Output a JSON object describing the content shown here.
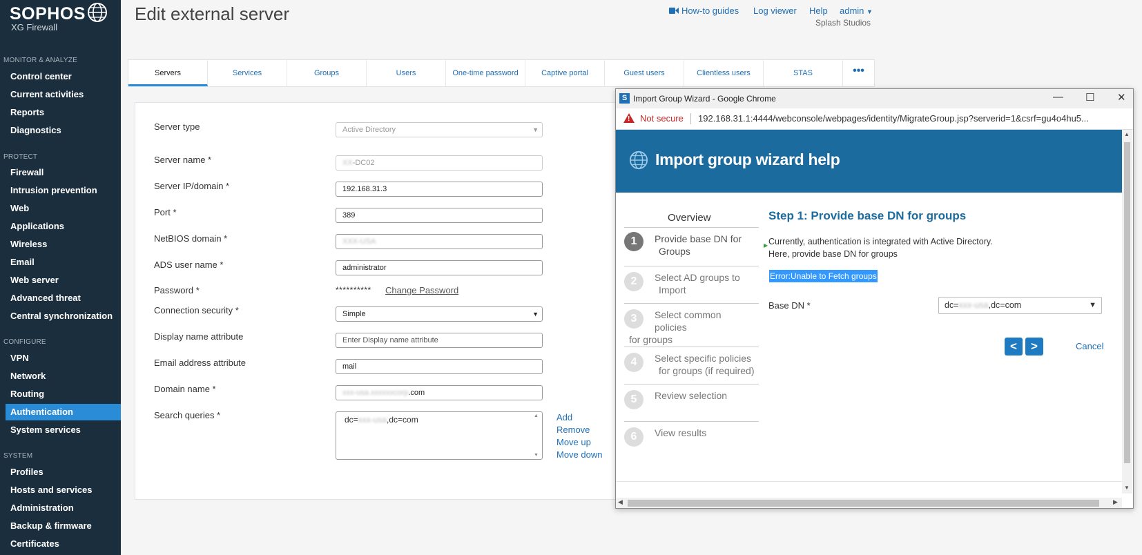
{
  "brand": {
    "name": "SOPHOS",
    "product": "XG Firewall"
  },
  "sidebar": {
    "sections": [
      {
        "title": "MONITOR & ANALYZE",
        "items": [
          "Control center",
          "Current activities",
          "Reports",
          "Diagnostics"
        ]
      },
      {
        "title": "PROTECT",
        "items": [
          "Firewall",
          "Intrusion prevention",
          "Web",
          "Applications",
          "Wireless",
          "Email",
          "Web server",
          "Advanced threat",
          "Central synchronization"
        ]
      },
      {
        "title": "CONFIGURE",
        "items": [
          "VPN",
          "Network",
          "Routing",
          "Authentication",
          "System services"
        ]
      },
      {
        "title": "SYSTEM",
        "items": [
          "Profiles",
          "Hosts and services",
          "Administration",
          "Backup & firmware",
          "Certificates"
        ]
      }
    ],
    "active": "Authentication"
  },
  "header": {
    "title": "Edit external server",
    "links": {
      "howto": "How-to guides",
      "logviewer": "Log viewer",
      "help": "Help",
      "admin": "admin"
    },
    "org": "Splash Studios"
  },
  "tabs": [
    "Servers",
    "Services",
    "Groups",
    "Users",
    "One-time password",
    "Captive portal",
    "Guest users",
    "Clientless users",
    "STAS"
  ],
  "form": {
    "server_type": {
      "label": "Server type",
      "value": "Active Directory"
    },
    "server_name": {
      "label": "Server name *",
      "value_suffix": "-DC02"
    },
    "server_ip": {
      "label": "Server IP/domain *",
      "value": "192.168.31.3"
    },
    "port": {
      "label": "Port *",
      "value": "389"
    },
    "netbios": {
      "label": "NetBIOS domain *"
    },
    "ads_user": {
      "label": "ADS user name *",
      "value": "administrator"
    },
    "password": {
      "label": "Password *",
      "dots": "**********",
      "change": "Change Password"
    },
    "connection_security": {
      "label": "Connection security *",
      "value": "Simple"
    },
    "display_name_attr": {
      "label": "Display name attribute",
      "placeholder": "Enter Display name attribute"
    },
    "email_attr": {
      "label": "Email address attribute",
      "value": "mail"
    },
    "domain_name": {
      "label": "Domain name *",
      "value_suffix": ".com"
    },
    "search_queries": {
      "label": "Search queries *",
      "prefix": "dc=",
      "suffix": ",dc=com"
    },
    "query_actions": {
      "add": "Add",
      "remove": "Remove",
      "move_up": "Move up",
      "move_down": "Move down"
    }
  },
  "popup": {
    "window_title": "Import Group Wizard - Google Chrome",
    "not_secure": "Not secure",
    "url": "192.168.31.1:4444/webconsole/webpages/identity/MigrateGroup.jsp?serverid=1&csrf=gu4o4hu5...",
    "header": "Import group wizard help",
    "overview": "Overview",
    "steps": [
      {
        "num": "1",
        "line1": "Provide base DN for",
        "line2": "Groups"
      },
      {
        "num": "2",
        "line1": "Select AD groups to",
        "line2": "Import"
      },
      {
        "num": "3",
        "line1": "Select common",
        "line2": "policies",
        "line3": "for groups"
      },
      {
        "num": "4",
        "line1": "Select specific policies",
        "line2": "for groups (if required)"
      },
      {
        "num": "5",
        "line1": "Review selection"
      },
      {
        "num": "6",
        "line1": "View results"
      }
    ],
    "step_title": "Step 1: Provide base DN for groups",
    "intro_line1": "Currently, authentication is integrated with Active Directory.",
    "intro_line2": "Here, provide base DN for groups",
    "error": "Error:Unable to Fetch groups",
    "base_dn_label": "Base DN *",
    "base_dn_prefix": "dc=",
    "base_dn_suffix": ",dc=com",
    "prev": "<",
    "next": ">",
    "cancel": "Cancel"
  }
}
